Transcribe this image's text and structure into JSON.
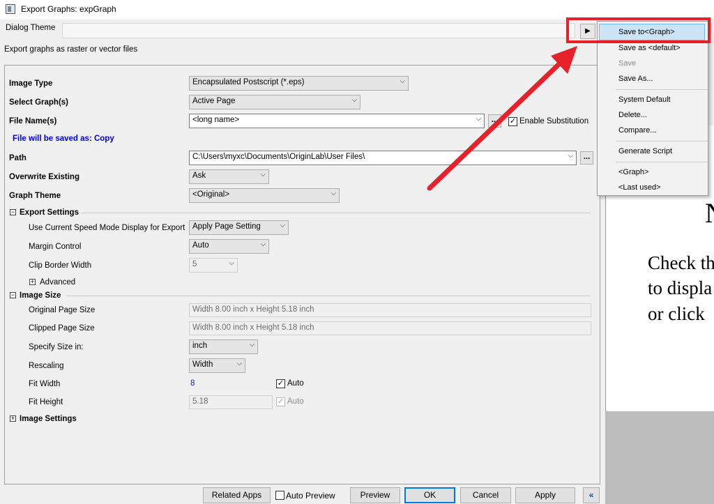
{
  "window": {
    "title": "Export Graphs: expGraph"
  },
  "theme": {
    "label": "Dialog Theme",
    "value": ""
  },
  "description": "Export graphs as raster or vector files",
  "form": {
    "image_type": {
      "label": "Image Type",
      "value": "Encapsulated Postscript (*.eps)"
    },
    "select_graphs": {
      "label": "Select Graph(s)",
      "value": "Active Page"
    },
    "file_name": {
      "label": "File Name(s)",
      "value": "<long name>",
      "browse": "...",
      "substitution_label": "Enable Substitution",
      "substitution_checked": true
    },
    "saved_as": "File will be saved as: Copy",
    "path": {
      "label": "Path",
      "value": "C:\\Users\\myxc\\Documents\\OriginLab\\User Files\\",
      "browse": "..."
    },
    "overwrite": {
      "label": "Overwrite Existing",
      "value": "Ask"
    },
    "graph_theme": {
      "label": "Graph Theme",
      "value": "<Original>"
    },
    "export_settings": {
      "label": "Export Settings",
      "expand": "−",
      "speed_mode": {
        "label": "Use Current Speed Mode Display for Export",
        "value": "Apply Page Setting"
      },
      "margin": {
        "label": "Margin Control",
        "value": "Auto"
      },
      "clip_border": {
        "label": "Clip Border Width",
        "value": "5"
      },
      "advanced": {
        "label": "Advanced",
        "expand": "+"
      }
    },
    "image_size": {
      "label": "Image Size",
      "expand": "−",
      "original": {
        "label": "Original Page Size",
        "value": "Width 8.00 inch x Height 5.18 inch"
      },
      "clipped": {
        "label": "Clipped Page Size",
        "value": "Width 8.00 inch x Height 5.18 inch"
      },
      "specify": {
        "label": "Specify Size in:",
        "value": "inch"
      },
      "rescaling": {
        "label": "Rescaling",
        "value": "Width"
      },
      "fit_width": {
        "label": "Fit Width",
        "value": "8",
        "auto_label": "Auto",
        "auto_checked": true
      },
      "fit_height": {
        "label": "Fit Height",
        "value": "5.18",
        "auto_label": "Auto",
        "auto_checked": true
      }
    },
    "image_settings": {
      "label": "Image Settings",
      "expand": "+"
    }
  },
  "menu": {
    "items": [
      {
        "label": "Save to<Graph>",
        "enabled": true,
        "highlighted": true
      },
      {
        "label": "Save as <default>",
        "enabled": true
      },
      {
        "label": "Save",
        "enabled": false
      },
      {
        "label": "Save As...",
        "enabled": true
      },
      {
        "label": "System Default",
        "enabled": true
      },
      {
        "label": "Delete...",
        "enabled": true
      },
      {
        "label": "Compare...",
        "enabled": true
      },
      {
        "label": "Generate Script",
        "enabled": true
      },
      {
        "label": "<Graph>",
        "enabled": true
      },
      {
        "label": "<Last used>",
        "enabled": true
      }
    ]
  },
  "preview": {
    "line1": "N",
    "line2": "Check th",
    "line3": "to displa",
    "line4": "or click"
  },
  "buttons": {
    "related_apps": "Related Apps",
    "auto_preview": "Auto Preview",
    "preview": "Preview",
    "ok": "OK",
    "cancel": "Cancel",
    "apply": "Apply",
    "collapse": "«"
  },
  "colors": {
    "annotation": "#e8202a",
    "menu_highlight": "#cce4f7",
    "link_blue": "#0000cc"
  }
}
